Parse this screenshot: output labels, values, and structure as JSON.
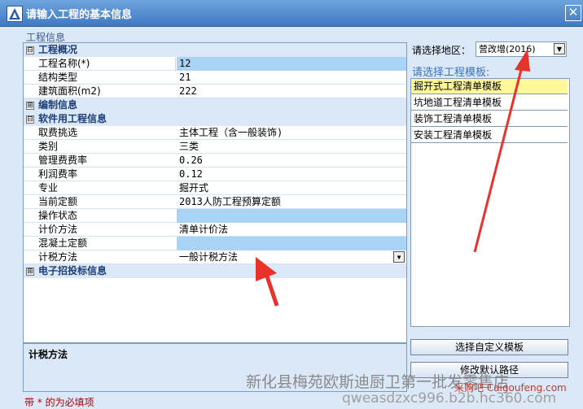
{
  "window": {
    "title": "请输入工程的基本信息",
    "close_glyph": "✕"
  },
  "group_label": "工程信息",
  "sections": [
    {
      "toggle": "⊟",
      "name": "工程概况",
      "rows": [
        {
          "label": "工程名称(*)",
          "value": "12",
          "highlight": true
        },
        {
          "label": "结构类型",
          "value": "21"
        },
        {
          "label": "建筑面积(m2)",
          "value": "222"
        }
      ]
    },
    {
      "toggle": "⊞",
      "name": "编制信息"
    },
    {
      "toggle": "⊟",
      "name": "软件用工程信息",
      "rows": [
        {
          "label": "取费挑选",
          "value": "主体工程（含一般装饰)"
        },
        {
          "label": "类别",
          "value": "三类"
        },
        {
          "label": "管理费费率",
          "value": "0.26"
        },
        {
          "label": "利润费率",
          "value": "0.12"
        },
        {
          "label": "专业",
          "value": "掘开式"
        },
        {
          "label": "当前定额",
          "value": "2013人防工程预算定额"
        },
        {
          "label": "操作状态",
          "value": "",
          "highlight": true
        },
        {
          "label": "计价方法",
          "value": "清单计价法"
        },
        {
          "label": "混凝土定额",
          "value": "",
          "highlight": true
        },
        {
          "label": "计税方法",
          "value": "一般计税方法",
          "dropdown": true
        }
      ]
    },
    {
      "toggle": "⊞",
      "name": "电子招投标信息"
    }
  ],
  "description": {
    "title": "计税方法"
  },
  "required_note": "带 * 的为必填项",
  "region": {
    "label": "请选择地区：",
    "value": "营改增(2016)"
  },
  "templates": {
    "label": "请选择工程模板:",
    "items": [
      "掘开式工程清单模板",
      "坑地道工程清单模板",
      "装饰工程清单模板",
      "安装工程清单模板"
    ],
    "selected_index": 0
  },
  "buttons": {
    "custom_template": "选择自定义模板",
    "modify_path": "修改默认路径"
  },
  "watermarks": {
    "company": "新化县梅苑欧斯迪厨卫第一批发零售店",
    "site": "采购吧 Caigoufeng.com",
    "domain": "qweasdzxc996.b2b.hc360.com"
  },
  "icons": {
    "dropdown": "dropdown-arrow-icon",
    "close": "close-icon",
    "app": "app-logo-icon"
  },
  "colors": {
    "title_bar": "#3f79c4",
    "highlight_cell": "#a9d4f7",
    "selected_template": "#fff799",
    "arrow": "#e8322b"
  }
}
